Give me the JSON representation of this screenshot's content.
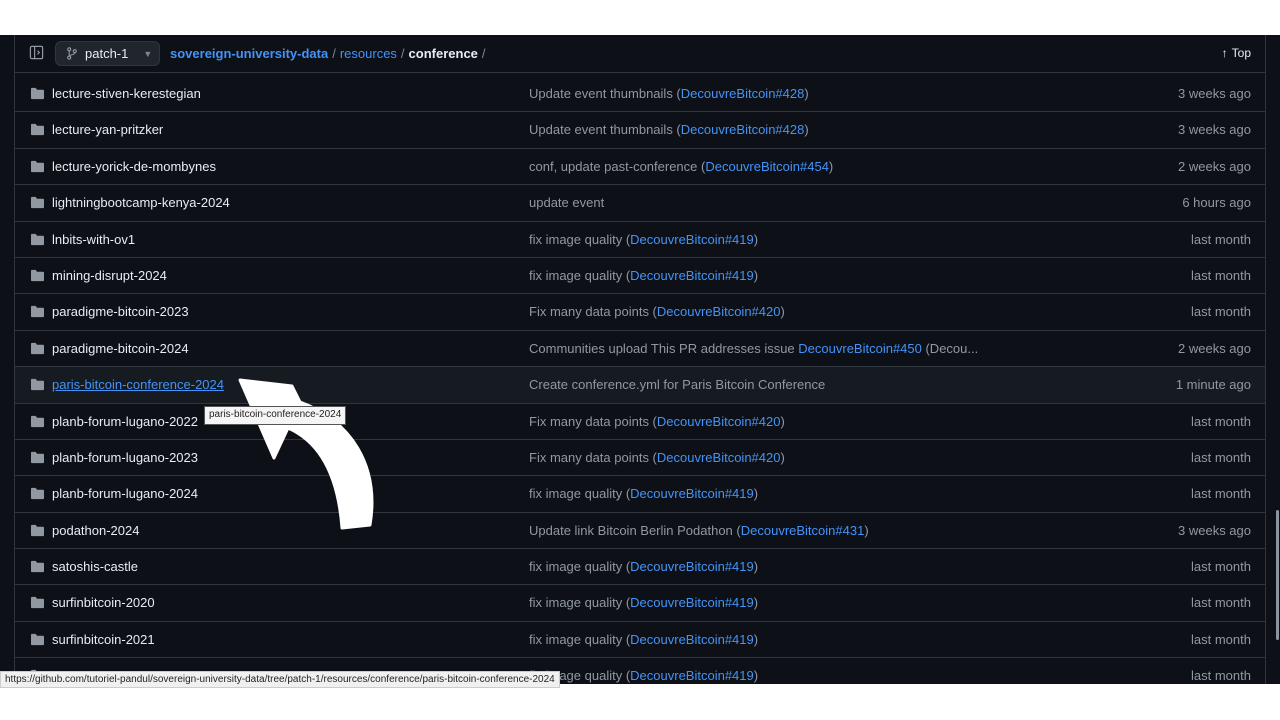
{
  "header": {
    "branch": "patch-1",
    "breadcrumb": {
      "repo": "sovereign-university-data",
      "sep1": "/",
      "folder": "resources",
      "sep2": "/",
      "current": "conference",
      "sep3": "/"
    },
    "top_label": "Top"
  },
  "rows": [
    {
      "name": "lecture-stiven-kerestegian",
      "msg": "Update event thumbnails (",
      "pr": "DecouvreBitcoin#428",
      "tail": ")",
      "date": "3 weeks ago"
    },
    {
      "name": "lecture-yan-pritzker",
      "msg": "Update event thumbnails (",
      "pr": "DecouvreBitcoin#428",
      "tail": ")",
      "date": "3 weeks ago"
    },
    {
      "name": "lecture-yorick-de-mombynes",
      "msg": "conf, update past-conference (",
      "pr": "DecouvreBitcoin#454",
      "tail": ")",
      "date": "2 weeks ago"
    },
    {
      "name": "lightningbootcamp-kenya-2024",
      "msg": "update event",
      "pr": "",
      "tail": "",
      "date": "6 hours ago"
    },
    {
      "name": "lnbits-with-ov1",
      "msg": "fix image quality (",
      "pr": "DecouvreBitcoin#419",
      "tail": ")",
      "date": "last month"
    },
    {
      "name": "mining-disrupt-2024",
      "msg": "fix image quality (",
      "pr": "DecouvreBitcoin#419",
      "tail": ")",
      "date": "last month"
    },
    {
      "name": "paradigme-bitcoin-2023",
      "msg": "Fix many data points (",
      "pr": "DecouvreBitcoin#420",
      "tail": ")",
      "date": "last month"
    },
    {
      "name": "paradigme-bitcoin-2024",
      "msg": "Communities upload This PR addresses issue ",
      "pr": "DecouvreBitcoin#450",
      "tail": " (Decou...",
      "date": "2 weeks ago"
    },
    {
      "name": "paris-bitcoin-conference-2024",
      "msg": "Create conference.yml for Paris Bitcoin Conference",
      "pr": "",
      "tail": "",
      "date": "1 minute ago"
    },
    {
      "name": "planb-forum-lugano-2022",
      "msg": "Fix many data points (",
      "pr": "DecouvreBitcoin#420",
      "tail": ")",
      "date": "last month"
    },
    {
      "name": "planb-forum-lugano-2023",
      "msg": "Fix many data points (",
      "pr": "DecouvreBitcoin#420",
      "tail": ")",
      "date": "last month"
    },
    {
      "name": "planb-forum-lugano-2024",
      "msg": "fix image quality (",
      "pr": "DecouvreBitcoin#419",
      "tail": ")",
      "date": "last month"
    },
    {
      "name": "podathon-2024",
      "msg": "Update link Bitcoin Berlin Podathon (",
      "pr": "DecouvreBitcoin#431",
      "tail": ")",
      "date": "3 weeks ago"
    },
    {
      "name": "satoshis-castle",
      "msg": "fix image quality (",
      "pr": "DecouvreBitcoin#419",
      "tail": ")",
      "date": "last month"
    },
    {
      "name": "surfinbitcoin-2020",
      "msg": "fix image quality (",
      "pr": "DecouvreBitcoin#419",
      "tail": ")",
      "date": "last month"
    },
    {
      "name": "surfinbitcoin-2021",
      "msg": "fix image quality (",
      "pr": "DecouvreBitcoin#419",
      "tail": ")",
      "date": "last month"
    },
    {
      "name": "",
      "msg": "fix image quality (",
      "pr": "DecouvreBitcoin#419",
      "tail": ")",
      "date": "last month"
    }
  ],
  "tooltip": "paris-bitcoin-conference-2024",
  "status_url": "https://github.com/tutoriel-pandul/sovereign-university-data/tree/patch-1/resources/conference/paris-bitcoin-conference-2024",
  "colors": {
    "background": "#0d1117",
    "link": "#4493f8",
    "border": "#30363d",
    "muted": "#9198a1"
  },
  "icons": [
    "sidebar-toggle-icon",
    "git-branch-icon",
    "chevron-down-icon",
    "arrow-up-icon",
    "folder-icon"
  ]
}
